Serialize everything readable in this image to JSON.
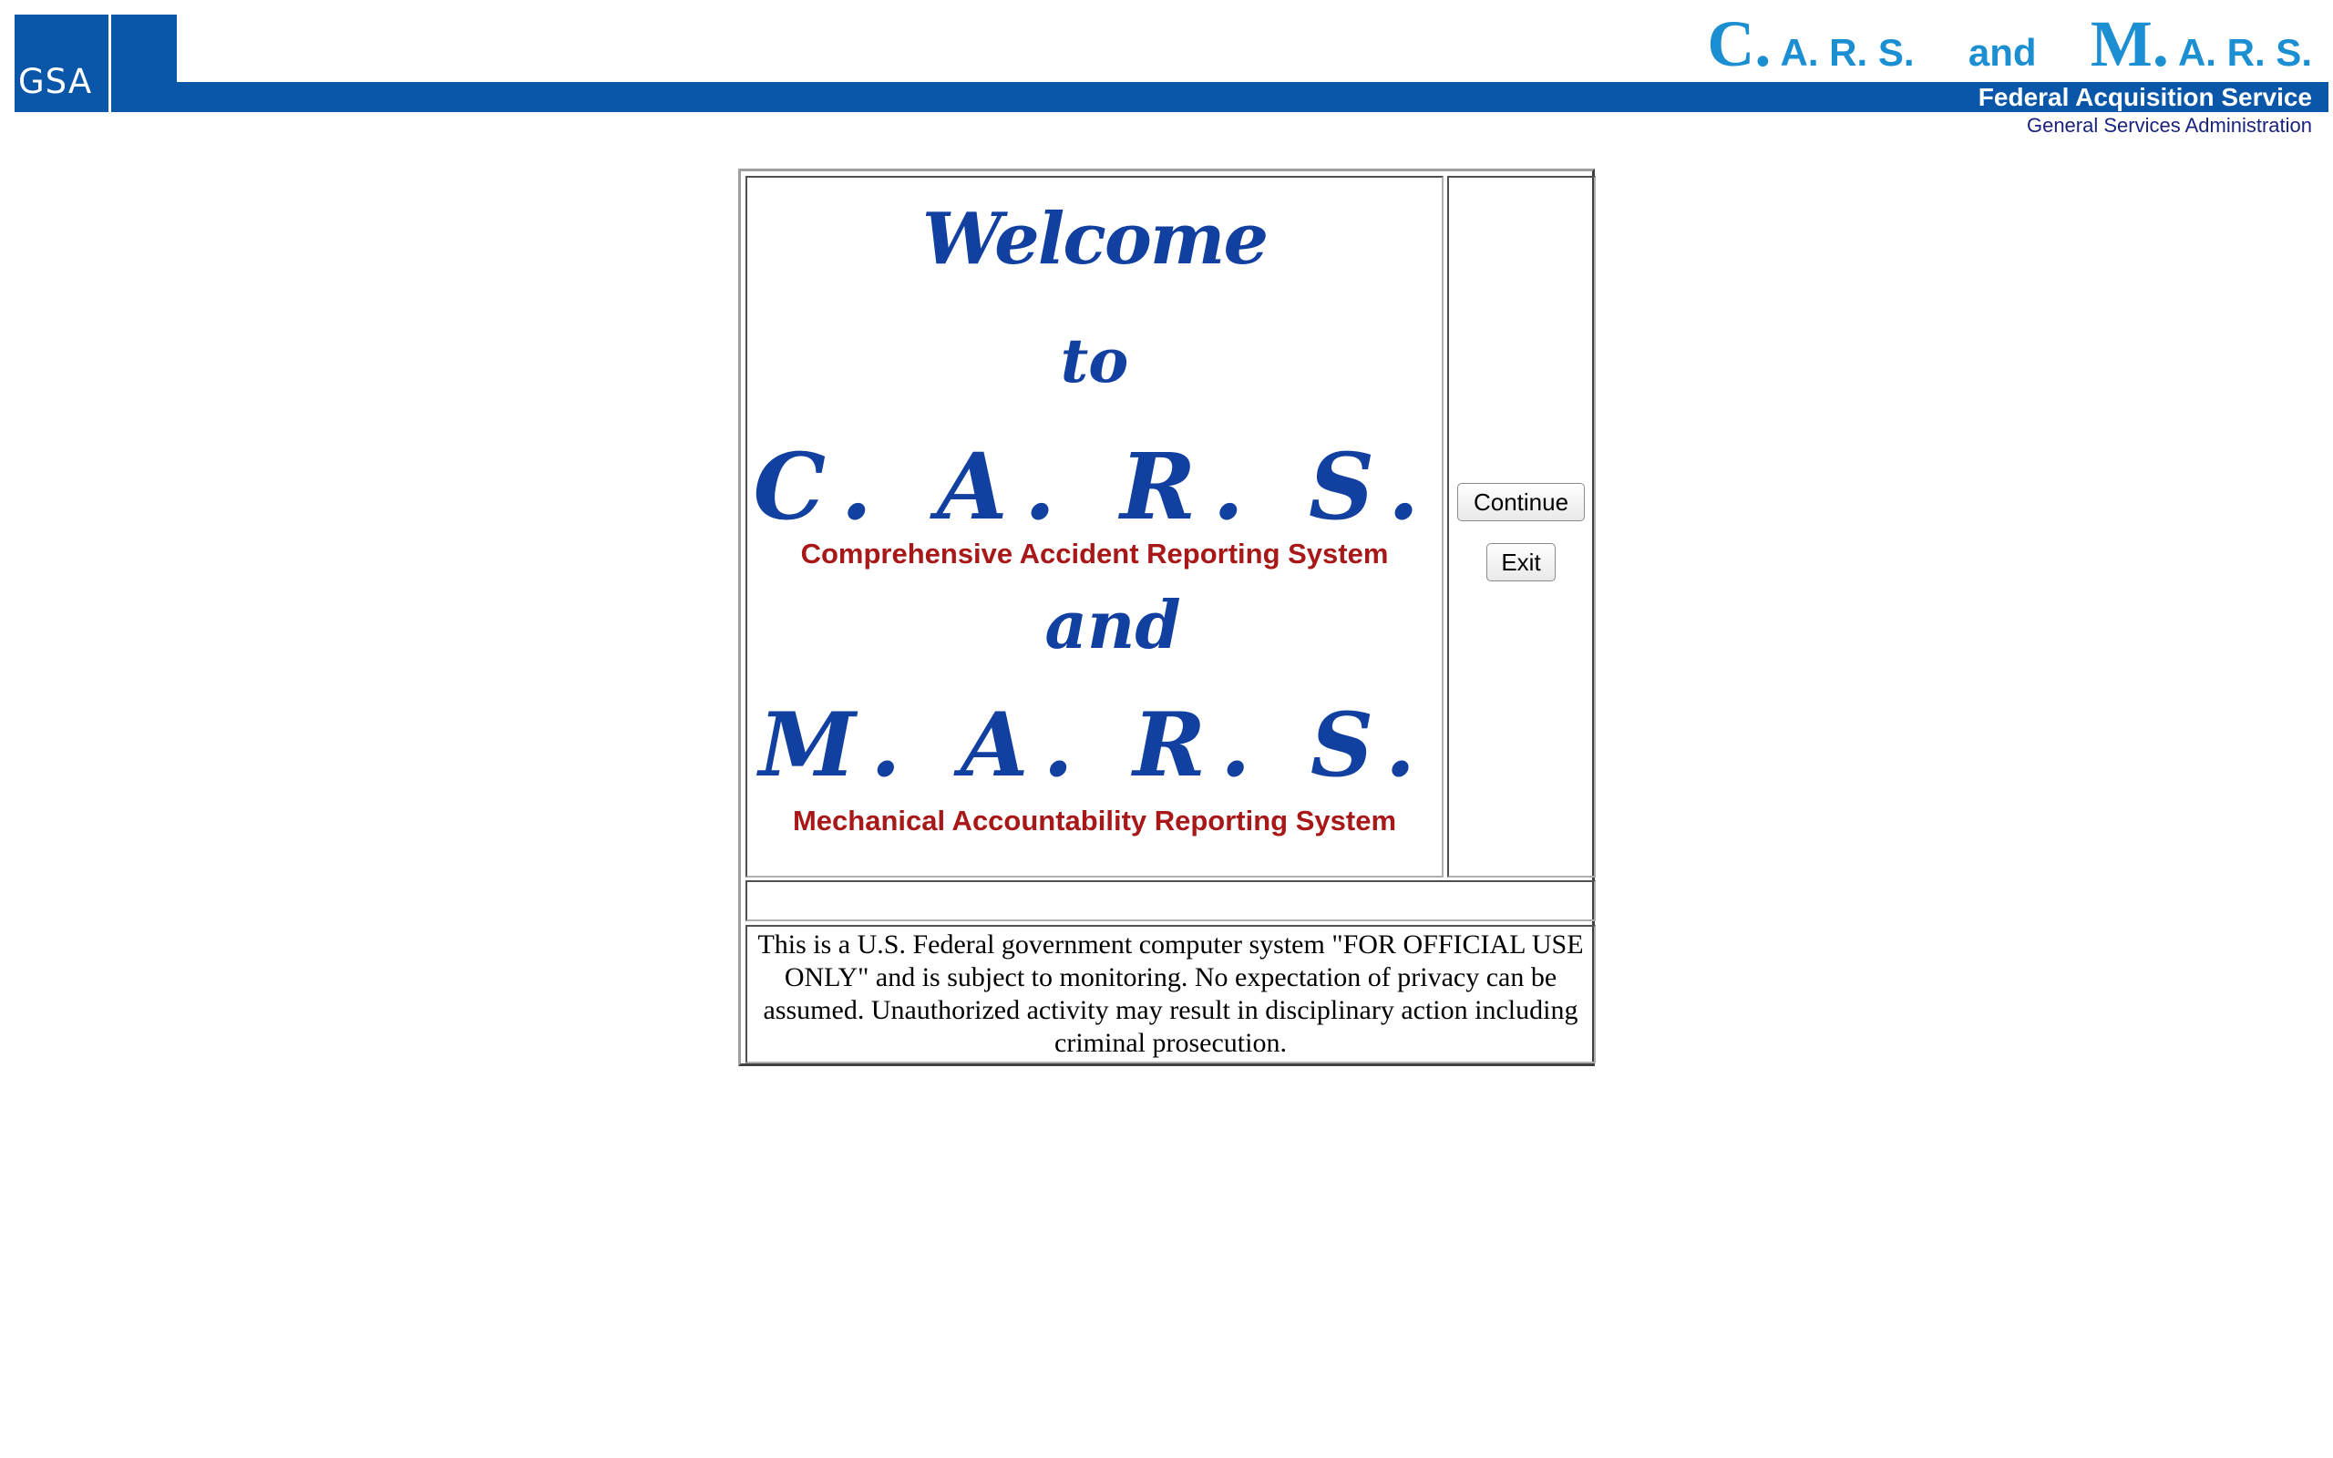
{
  "header": {
    "logo_text": "GSA",
    "title": {
      "part1_initial": "C.",
      "part1_rest": "A. R. S.",
      "conjunction": "and",
      "part2_initial": "M.",
      "part2_rest": "A. R. S."
    },
    "agency": "Federal Acquisition Service",
    "agency_sub": "General Services Administration"
  },
  "welcome": {
    "line1": "Welcome",
    "line2": "to",
    "cars": "C. A. R. S.",
    "cars_full": "Comprehensive Accident Reporting System",
    "conjunction": "and",
    "mars": "M. A. R. S.",
    "mars_full": "Mechanical Accountability Reporting System"
  },
  "buttons": {
    "continue": "Continue",
    "exit": "Exit"
  },
  "notice": "This is a U.S. Federal government computer system \"FOR OFFICIAL USE ONLY\" and is subject to monitoring. No expectation of privacy can be assumed. Unauthorized activity may result in disciplinary action including criminal prosecution.",
  "colors": {
    "brand_blue": "#0a56a8",
    "title_blue": "#1b8fd1",
    "script_blue": "#1240a0",
    "subtitle_red": "#a81818"
  }
}
